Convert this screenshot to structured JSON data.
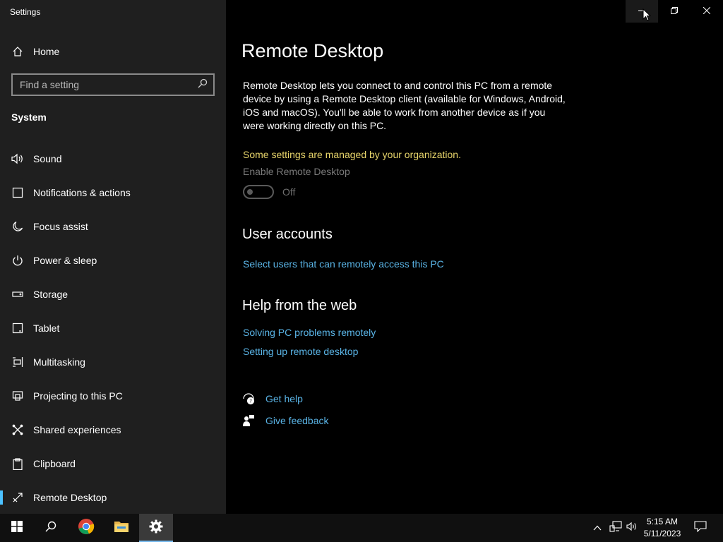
{
  "window": {
    "app_title": "Settings"
  },
  "sidebar": {
    "home_label": "Home",
    "search_placeholder": "Find a setting",
    "section_label": "System",
    "items": [
      {
        "label": "Sound",
        "icon": "speaker-icon"
      },
      {
        "label": "Notifications & actions",
        "icon": "notification-icon"
      },
      {
        "label": "Focus assist",
        "icon": "moon-icon"
      },
      {
        "label": "Power & sleep",
        "icon": "power-icon"
      },
      {
        "label": "Storage",
        "icon": "storage-icon"
      },
      {
        "label": "Tablet",
        "icon": "tablet-icon"
      },
      {
        "label": "Multitasking",
        "icon": "multitasking-icon"
      },
      {
        "label": "Projecting to this PC",
        "icon": "projecting-icon"
      },
      {
        "label": "Shared experiences",
        "icon": "shared-experiences-icon"
      },
      {
        "label": "Clipboard",
        "icon": "clipboard-icon"
      },
      {
        "label": "Remote Desktop",
        "icon": "remote-desktop-icon",
        "selected": true
      }
    ]
  },
  "main": {
    "title": "Remote Desktop",
    "description": "Remote Desktop lets you connect to and control this PC from a remote device by using a Remote Desktop client (available for Windows, Android, iOS and macOS). You'll be able to work from another device as if you were working directly on this PC.",
    "managed_notice": "Some settings are managed by your organization.",
    "enable_label": "Enable Remote Desktop",
    "toggle_state": "Off",
    "user_accounts_heading": "User accounts",
    "select_users_link": "Select users that can remotely access this PC",
    "help_heading": "Help from the web",
    "help_links": [
      "Solving PC problems remotely",
      "Setting up remote desktop"
    ],
    "get_help": "Get help",
    "give_feedback": "Give feedback"
  },
  "taskbar": {
    "time": "5:15 AM",
    "date": "5/11/2023"
  },
  "colors": {
    "accent": "#4cc2ff",
    "link": "#5ab4e6",
    "warning": "#e8d56b"
  }
}
